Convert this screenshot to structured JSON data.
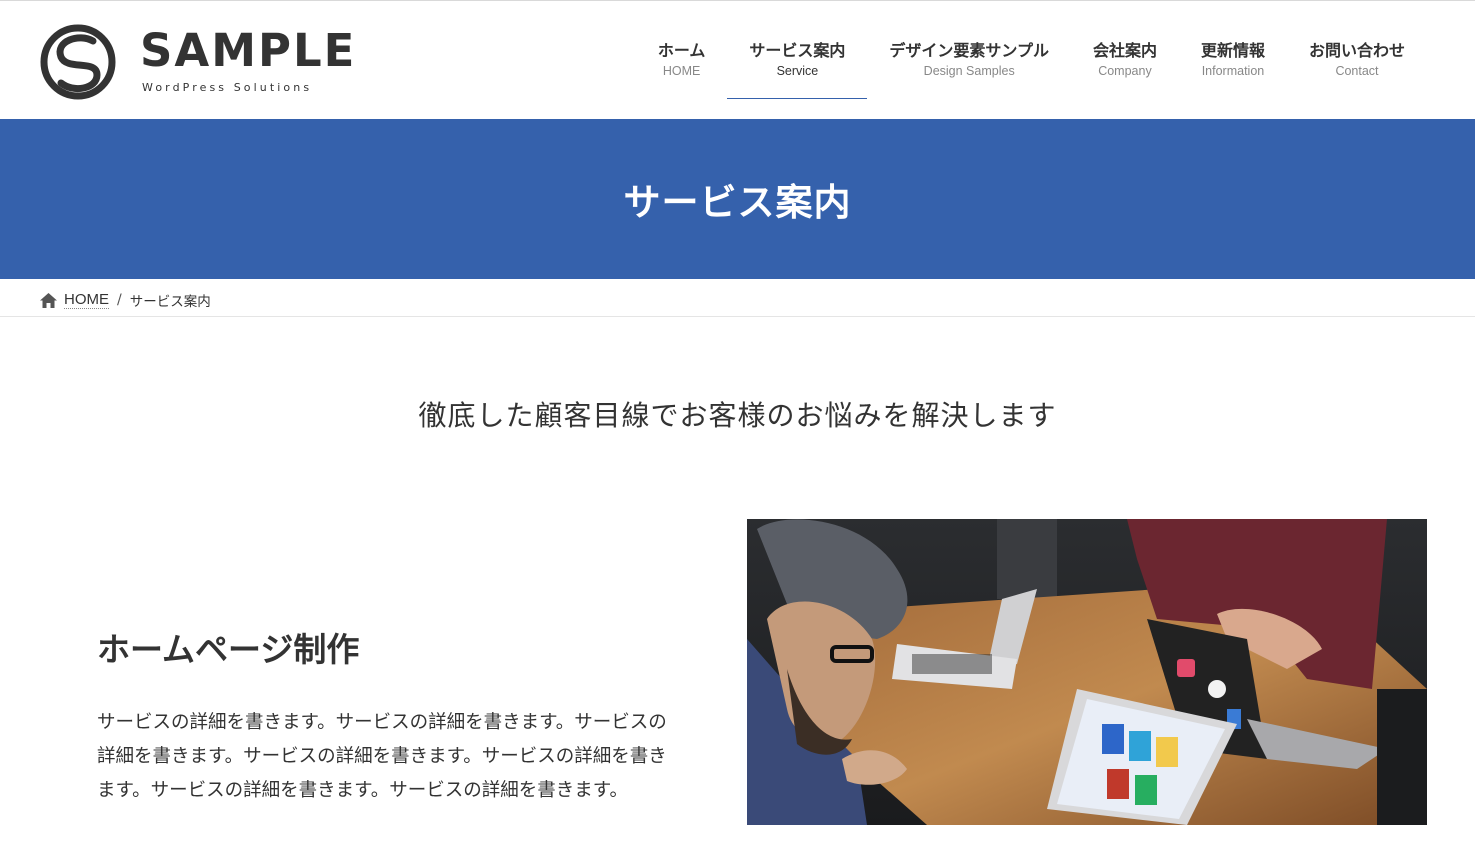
{
  "logo": {
    "title": "SAMPLE",
    "subtitle": "WordPress Solutions",
    "icon": "s-swirl-logo"
  },
  "nav": {
    "items": [
      {
        "label": "ホーム",
        "sub": "HOME"
      },
      {
        "label": "サービス案内",
        "sub": "Service",
        "active": true
      },
      {
        "label": "デザイン要素サンプル",
        "sub": "Design Samples"
      },
      {
        "label": "会社案内",
        "sub": "Company"
      },
      {
        "label": "更新情報",
        "sub": "Information"
      },
      {
        "label": "お問い合わせ",
        "sub": "Contact"
      }
    ]
  },
  "page_header": {
    "title": "サービス案内"
  },
  "breadcrumb": {
    "home": "HOME",
    "separator": "/",
    "current": "サービス案内",
    "home_icon": "house-icon"
  },
  "lead": "徹底した顧客目線でお客様のお悩みを解決します",
  "service": {
    "title": "ホームページ制作",
    "text": "サービスの詳細を書きます。サービスの詳細を書きます。サービスの詳細を書きます。サービスの詳細を書きます。サービスの詳細を書きます。サービスの詳細を書きます。サービスの詳細を書きます。",
    "image": "team-meeting-photo"
  },
  "colors": {
    "accent": "#3561ac",
    "text": "#333333",
    "muted": "#888888"
  }
}
